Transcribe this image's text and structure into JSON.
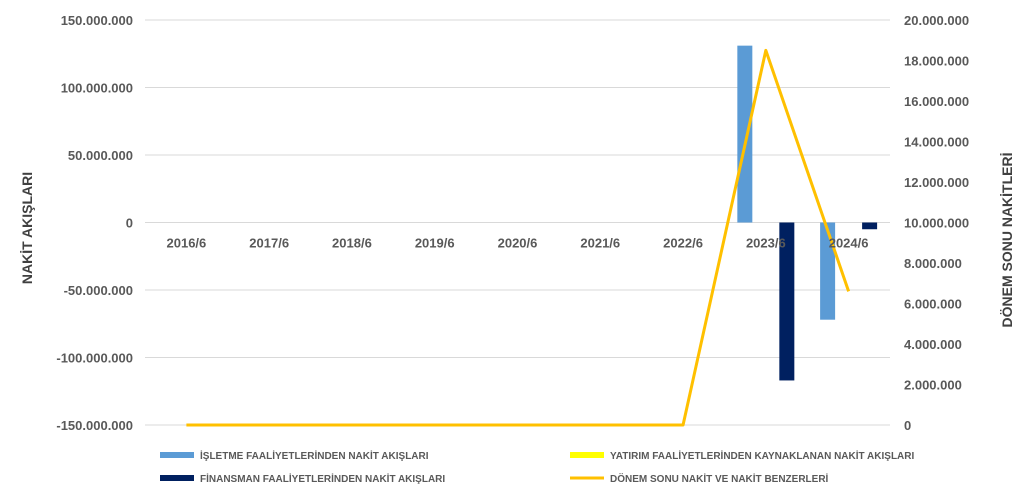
{
  "chart_data": {
    "type": "bar",
    "categories": [
      "2016/6",
      "2017/6",
      "2018/6",
      "2019/6",
      "2020/6",
      "2021/6",
      "2022/6",
      "2023/6",
      "2024/6"
    ],
    "ylabel": "NAKİT AKIŞLARI",
    "y2label": "DÖNEM SONU NAKİTLERİ",
    "ylim": [
      -150000000,
      150000000
    ],
    "y2lim": [
      0,
      20000000
    ],
    "yticks": [
      "150.000.000",
      "100.000.000",
      "50.000.000",
      "0",
      "-50.000.000",
      "-100.000.000",
      "-150.000.000"
    ],
    "y2ticks": [
      "20.000.000",
      "18.000.000",
      "16.000.000",
      "14.000.000",
      "12.000.000",
      "10.000.000",
      "8.000.000",
      "6.000.000",
      "4.000.000",
      "2.000.000",
      "0"
    ],
    "grid": true,
    "legend_position": "bottom",
    "series": [
      {
        "name": "İŞLETME FAALİYETLERİNDEN NAKİT AKIŞLARI",
        "kind": "bar",
        "axis": "left",
        "color": "#5b9bd5",
        "values": [
          0,
          0,
          0,
          0,
          0,
          0,
          0,
          131000000,
          -72000000
        ]
      },
      {
        "name": "YATIRIM FAALİYETLERİNDEN KAYNAKLANAN NAKİT AKIŞLARI",
        "kind": "bar",
        "axis": "left",
        "color": "#ffff00",
        "values": [
          0,
          0,
          0,
          0,
          0,
          0,
          0,
          0,
          0
        ]
      },
      {
        "name": "FİNANSMAN FAALİYETLERİNDEN NAKİT AKIŞLARI",
        "kind": "bar",
        "axis": "left",
        "color": "#002060",
        "values": [
          0,
          0,
          0,
          0,
          0,
          0,
          0,
          -117000000,
          -5000000
        ]
      },
      {
        "name": "DÖNEM SONU NAKİT VE NAKİT BENZERLERİ",
        "kind": "line",
        "axis": "right",
        "color": "#ffc000",
        "values": [
          0,
          0,
          0,
          0,
          0,
          0,
          0,
          18500000,
          6600000
        ]
      }
    ]
  }
}
